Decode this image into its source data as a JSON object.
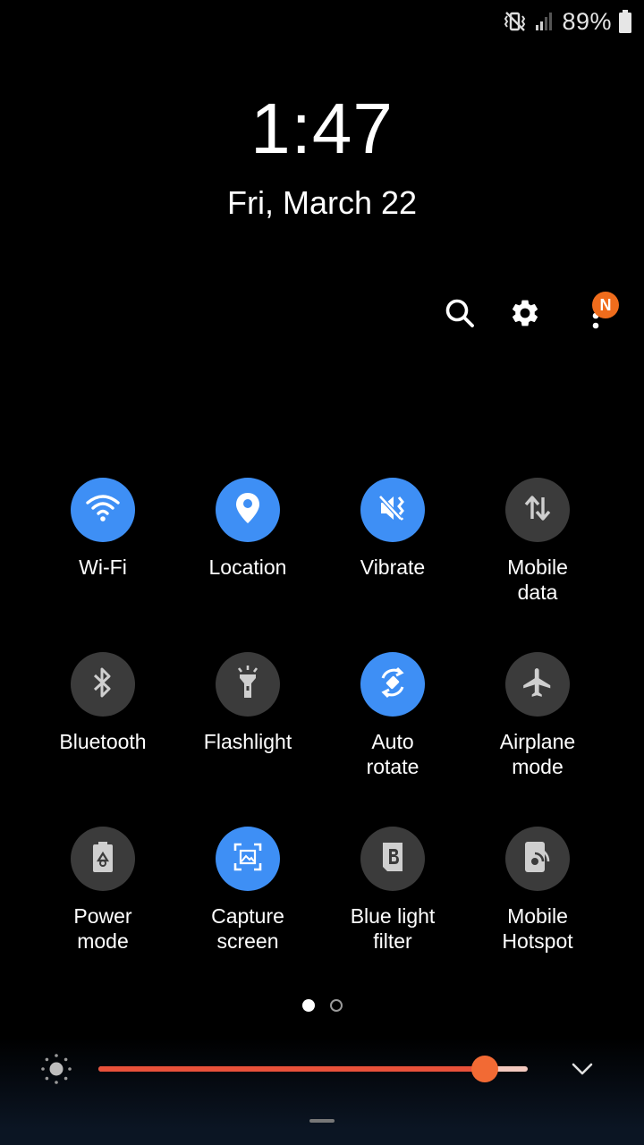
{
  "status_bar": {
    "battery_percent": "89%",
    "icons": [
      "vibrate-mute-icon",
      "signal-icon",
      "battery-icon"
    ]
  },
  "lockscreen": {
    "time": "1:47",
    "date": "Fri, March 22"
  },
  "header": {
    "actions": [
      "search-icon",
      "settings-icon",
      "more-options-icon"
    ],
    "notification_badge": "N",
    "badge_color": "#ef6c1c"
  },
  "quick_settings": {
    "accent_on": "#3e8ff5",
    "tile_off": "#3b3b3b",
    "tiles": [
      {
        "label": "Wi-Fi",
        "icon": "wifi-icon",
        "on": true
      },
      {
        "label": "Location",
        "icon": "location-pin-icon",
        "on": true
      },
      {
        "label": "Vibrate",
        "icon": "vibrate-icon",
        "on": true
      },
      {
        "label": "Mobile\ndata",
        "icon": "data-arrows-icon",
        "on": false
      },
      {
        "label": "Bluetooth",
        "icon": "bluetooth-icon",
        "on": false
      },
      {
        "label": "Flashlight",
        "icon": "flashlight-icon",
        "on": false
      },
      {
        "label": "Auto\nrotate",
        "icon": "auto-rotate-icon",
        "on": true
      },
      {
        "label": "Airplane\nmode",
        "icon": "airplane-icon",
        "on": false
      },
      {
        "label": "Power\nmode",
        "icon": "power-mode-icon",
        "on": false
      },
      {
        "label": "Capture\nscreen",
        "icon": "capture-screen-icon",
        "on": true
      },
      {
        "label": "Blue light\nfilter",
        "icon": "blue-light-filter-icon",
        "on": false
      },
      {
        "label": "Mobile\nHotspot",
        "icon": "hotspot-icon",
        "on": false
      }
    ]
  },
  "pagination": {
    "current_page": 1,
    "total_pages": 2
  },
  "brightness": {
    "level_fraction": 0.9,
    "fill_color": "#e9513a",
    "thumb_color": "#f26a34"
  }
}
